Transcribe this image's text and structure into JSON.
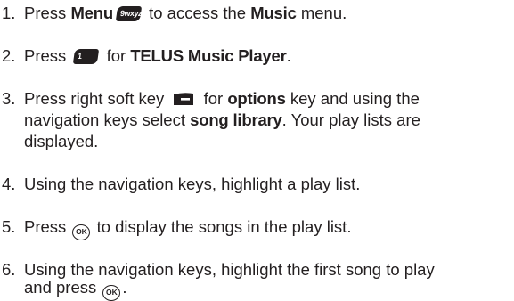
{
  "steps": [
    {
      "num": "1.",
      "a": "Press ",
      "b": "Menu",
      "key": "9wxyz",
      "c": " to access the ",
      "d": "Music",
      "e": " menu."
    },
    {
      "num": "2.",
      "a": "Press ",
      "key": "1",
      "c": " for ",
      "d": "TELUS Music Player",
      "e": "."
    },
    {
      "num": "3.",
      "line1a": "Press right soft key ",
      "line1b": " for ",
      "line1c": "options",
      "line1d": " key and using the",
      "line2a": "navigation keys select ",
      "line2b": "song library",
      "line2c": ". Your play lists are",
      "line3": "displayed."
    },
    {
      "num": "4.",
      "text": "Using the navigation keys, highlight a play list."
    },
    {
      "num": "5.",
      "a": "Press ",
      "ok": "OK",
      "c": " to display the songs in the play list."
    },
    {
      "num": "6.",
      "line1": "Using the navigation keys, highlight the first song to play",
      "line2a": "and press ",
      "ok": "OK",
      "line2b": "."
    }
  ]
}
